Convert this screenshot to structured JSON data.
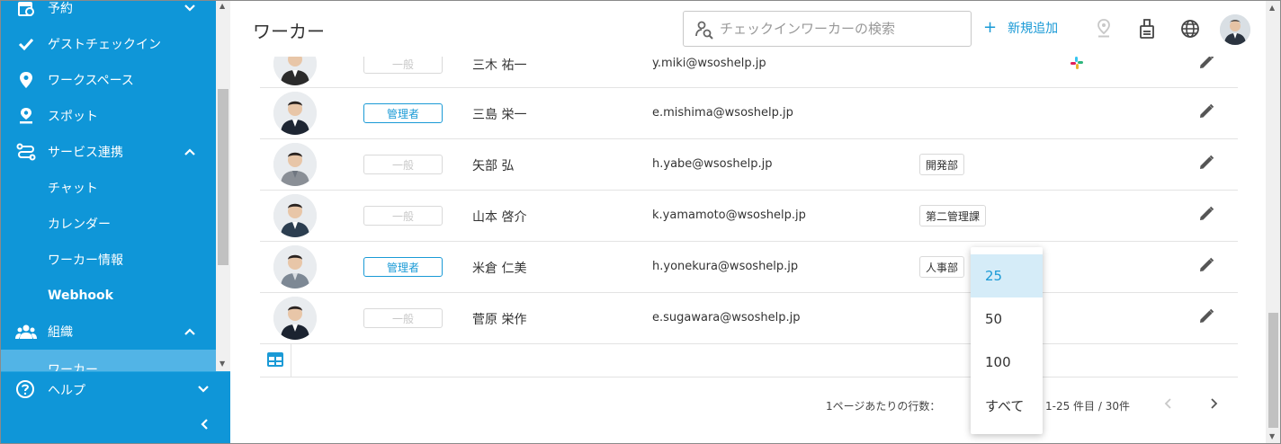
{
  "sidebar": {
    "items": [
      {
        "label": "予約",
        "icon": "calendar-icon"
      },
      {
        "label": "ゲストチェックイン",
        "icon": "check-icon"
      },
      {
        "label": "ワークスペース",
        "icon": "location-pin-icon"
      },
      {
        "label": "スポット",
        "icon": "spot-pin-icon"
      },
      {
        "label": "サービス連携",
        "icon": "integration-icon"
      },
      {
        "label": "チャット"
      },
      {
        "label": "カレンダー"
      },
      {
        "label": "ワーカー情報"
      },
      {
        "label": "Webhook"
      },
      {
        "label": "組織",
        "icon": "people-icon"
      },
      {
        "label": "ワーカー"
      }
    ],
    "help_label": "ヘルプ"
  },
  "header": {
    "title": "ワーカー",
    "search_placeholder": "チェックインワーカーの検索",
    "add_label": "新規追加"
  },
  "workers": [
    {
      "role": "一般",
      "name": "三木 祐一",
      "email": "y.miki@wsoshelp.jp",
      "dept": "",
      "slack": true
    },
    {
      "role": "管理者",
      "name": "三島 栄一",
      "email": "e.mishima@wsoshelp.jp",
      "dept": ""
    },
    {
      "role": "一般",
      "name": "矢部 弘",
      "email": "h.yabe@wsoshelp.jp",
      "dept": "開発部"
    },
    {
      "role": "一般",
      "name": "山本 啓介",
      "email": "k.yamamoto@wsoshelp.jp",
      "dept": "第二管理課"
    },
    {
      "role": "管理者",
      "name": "米倉 仁美",
      "email": "h.yonekura@wsoshelp.jp",
      "dept": "人事部"
    },
    {
      "role": "一般",
      "name": "菅原 栄作",
      "email": "e.sugawara@wsoshelp.jp",
      "dept": ""
    }
  ],
  "pagination": {
    "rows_per_page_label": "1ページあたりの行数：",
    "range": "1-25 件目 / 30件",
    "options": [
      "25",
      "50",
      "100",
      "すべて"
    ],
    "selected": "25"
  },
  "colors": {
    "sidebar": "#0f96d8",
    "accent": "#1a9ad6",
    "active_item": "#52b4e6"
  }
}
